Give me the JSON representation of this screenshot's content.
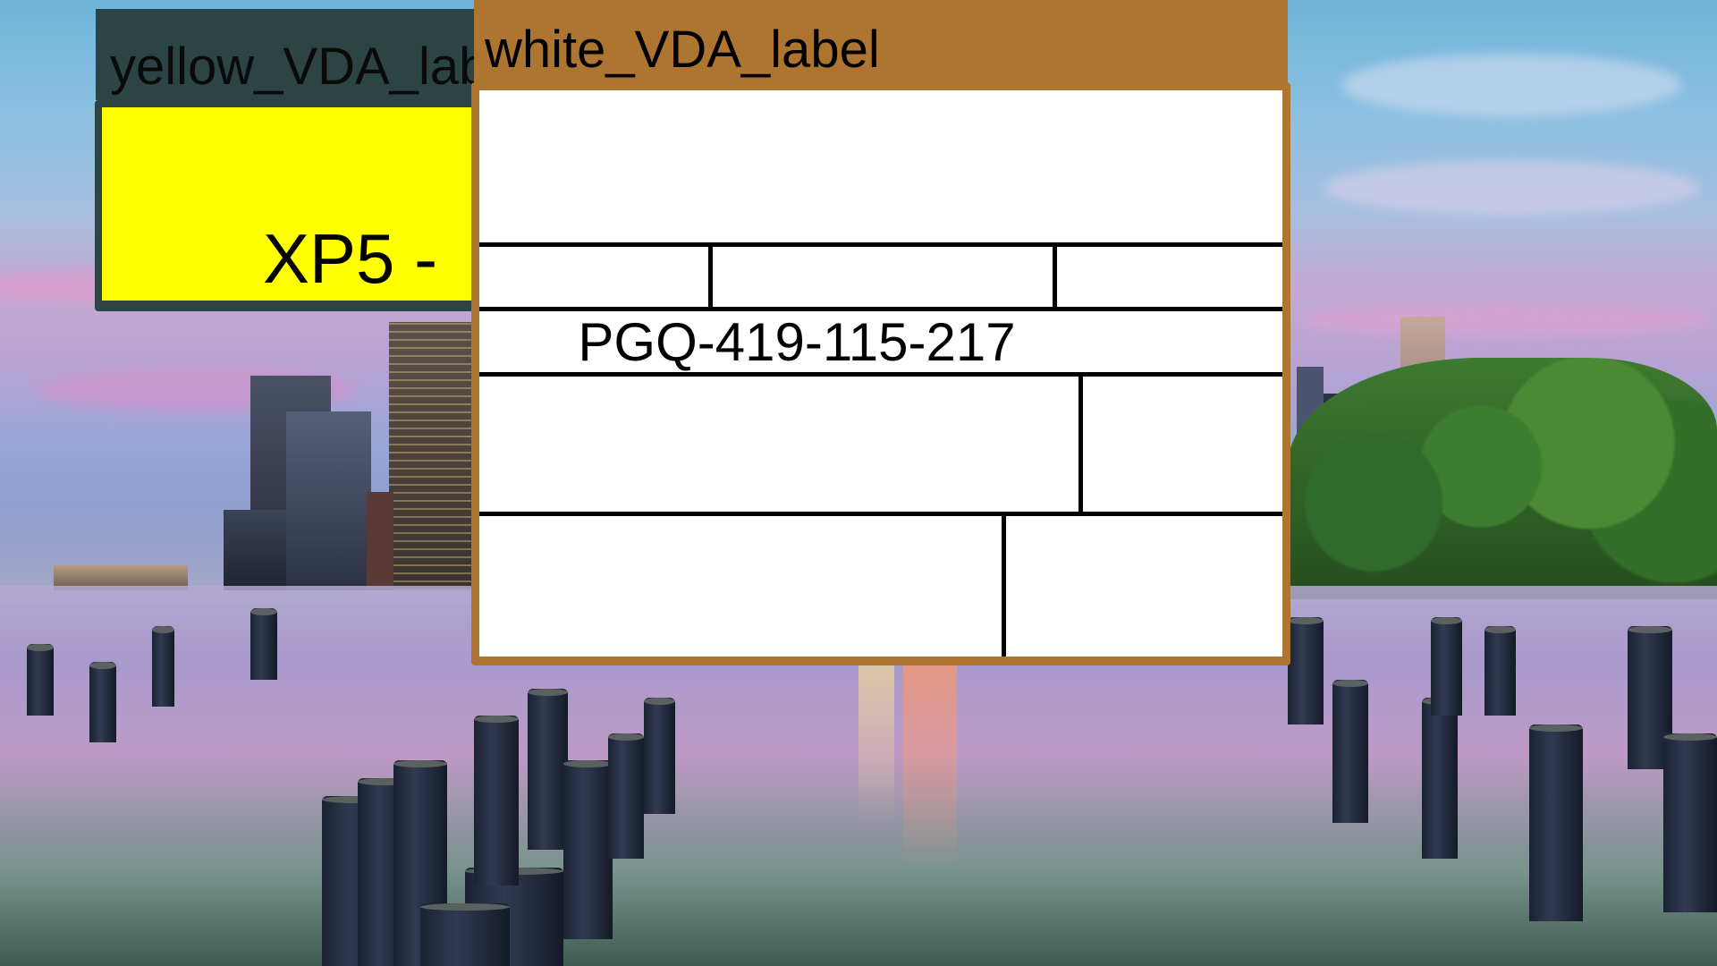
{
  "desktop": {
    "wallpaper": "city-skyline-pier-sunset"
  },
  "yellow_window": {
    "title": "yellow_VDA_label",
    "value_text": "XP5 - ",
    "title_bar_color": "#2c4444",
    "body_color": "#ffff00"
  },
  "white_window": {
    "title": "white_VDA_label",
    "code": "PGQ-419-115-217",
    "title_bar_color": "#ae7530",
    "body_color": "#ffffff"
  }
}
